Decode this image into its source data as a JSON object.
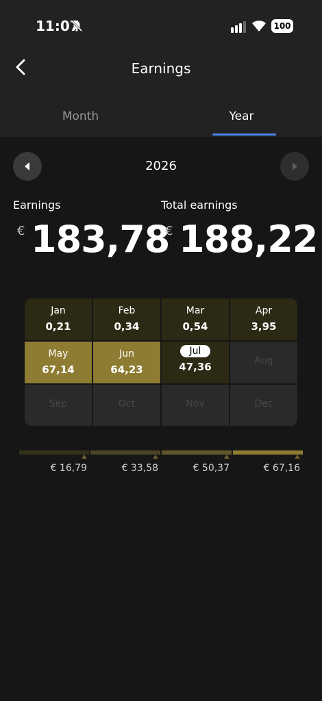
{
  "status": {
    "time": "11:07",
    "battery": "100"
  },
  "header": {
    "title": "Earnings",
    "tabs": [
      "Month",
      "Year"
    ],
    "active_tab": "Year"
  },
  "year_nav": {
    "year": "2026"
  },
  "summary": {
    "earnings_label": "Earnings",
    "earnings_currency": "€",
    "earnings_value": "183,78",
    "total_label": "Total earnings",
    "total_currency": "€",
    "total_value": "188,22"
  },
  "months": [
    {
      "month": "Jan",
      "value": "0,21"
    },
    {
      "month": "Feb",
      "value": "0,34"
    },
    {
      "month": "Mar",
      "value": "0,54"
    },
    {
      "month": "Apr",
      "value": "3,95"
    },
    {
      "month": "May",
      "value": "67,14"
    },
    {
      "month": "Jun",
      "value": "64,23"
    },
    {
      "month": "Jul",
      "value": "47,36"
    },
    {
      "month": "Aug",
      "value": ""
    },
    {
      "month": "Sep",
      "value": ""
    },
    {
      "month": "Oct",
      "value": ""
    },
    {
      "month": "Nov",
      "value": ""
    },
    {
      "month": "Dec",
      "value": ""
    }
  ],
  "selected_month": "Jul",
  "legend": [
    "€ 16,79",
    "€ 33,58",
    "€ 50,37",
    "€ 67,16"
  ],
  "colors": {
    "accent": "#4d86f0",
    "low": "#2c2a14",
    "high": "#8e7c33",
    "empty": "#2a2a2a"
  }
}
